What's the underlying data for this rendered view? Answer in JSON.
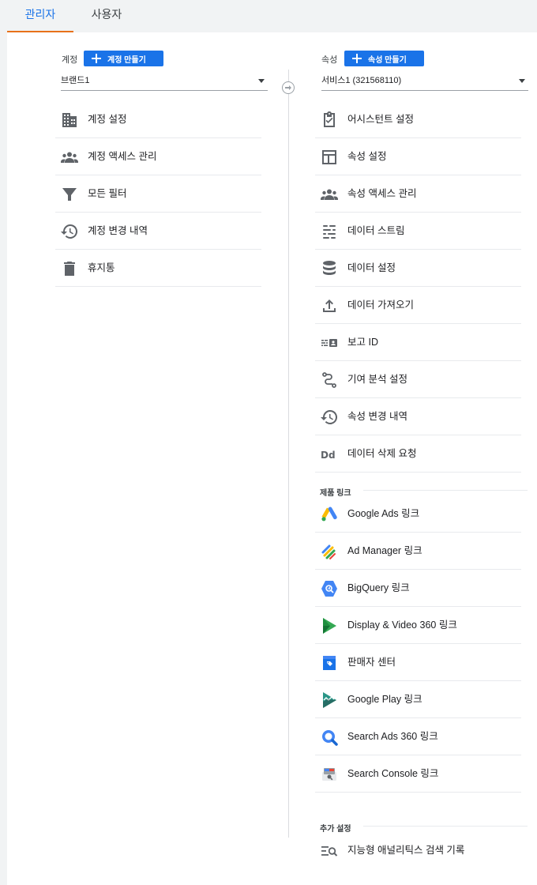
{
  "tabs": [
    {
      "label": "관리자"
    },
    {
      "label": "사용자"
    }
  ],
  "account": {
    "header_label": "계정",
    "create_label": "계정 만들기",
    "selected": "브랜드1",
    "items": [
      {
        "label": "계정 설정",
        "icon": "building-icon"
      },
      {
        "label": "계정 액세스 관리",
        "icon": "people-icon"
      },
      {
        "label": "모든 필터",
        "icon": "filter-icon"
      },
      {
        "label": "계정 변경 내역",
        "icon": "history-icon"
      },
      {
        "label": "휴지통",
        "icon": "trash-icon"
      }
    ]
  },
  "property": {
    "header_label": "속성",
    "create_label": "속성 만들기",
    "selected": "서비스1 (321568110)",
    "items": [
      {
        "label": "어시스턴트 설정",
        "icon": "clipboard-check-icon"
      },
      {
        "label": "속성 설정",
        "icon": "layout-icon"
      },
      {
        "label": "속성 액세스 관리",
        "icon": "people-icon"
      },
      {
        "label": "데이터 스트림",
        "icon": "streams-icon"
      },
      {
        "label": "데이터 설정",
        "icon": "database-icon"
      },
      {
        "label": "데이터 가져오기",
        "icon": "upload-icon"
      },
      {
        "label": "보고 ID",
        "icon": "reporting-id-icon"
      },
      {
        "label": "기여 분석 설정",
        "icon": "attribution-icon"
      },
      {
        "label": "속성 변경 내역",
        "icon": "history-icon"
      },
      {
        "label": "데이터 삭제 요청",
        "icon": "data-deletion-icon"
      }
    ],
    "product_links_title": "제품 링크",
    "product_links": [
      {
        "label": "Google Ads 링크",
        "icon": "google-ads-icon"
      },
      {
        "label": "Ad Manager 링크",
        "icon": "ad-manager-icon"
      },
      {
        "label": "BigQuery 링크",
        "icon": "bigquery-icon"
      },
      {
        "label": "Display & Video 360 링크",
        "icon": "display-video-360-icon"
      },
      {
        "label": "판매자 센터",
        "icon": "merchant-center-icon"
      },
      {
        "label": "Google Play 링크",
        "icon": "google-play-icon"
      },
      {
        "label": "Search Ads 360 링크",
        "icon": "search-ads-360-icon"
      },
      {
        "label": "Search Console 링크",
        "icon": "search-console-icon"
      }
    ],
    "extra_settings_title": "추가 설정",
    "extra_settings": [
      {
        "label": "지능형 애널리틱스 검색 기록",
        "icon": "search-history-icon"
      }
    ]
  },
  "colors": {
    "accent_blue": "#1a73e8",
    "tab_underline": "#e8711a",
    "icon_gray": "#5f6368"
  }
}
